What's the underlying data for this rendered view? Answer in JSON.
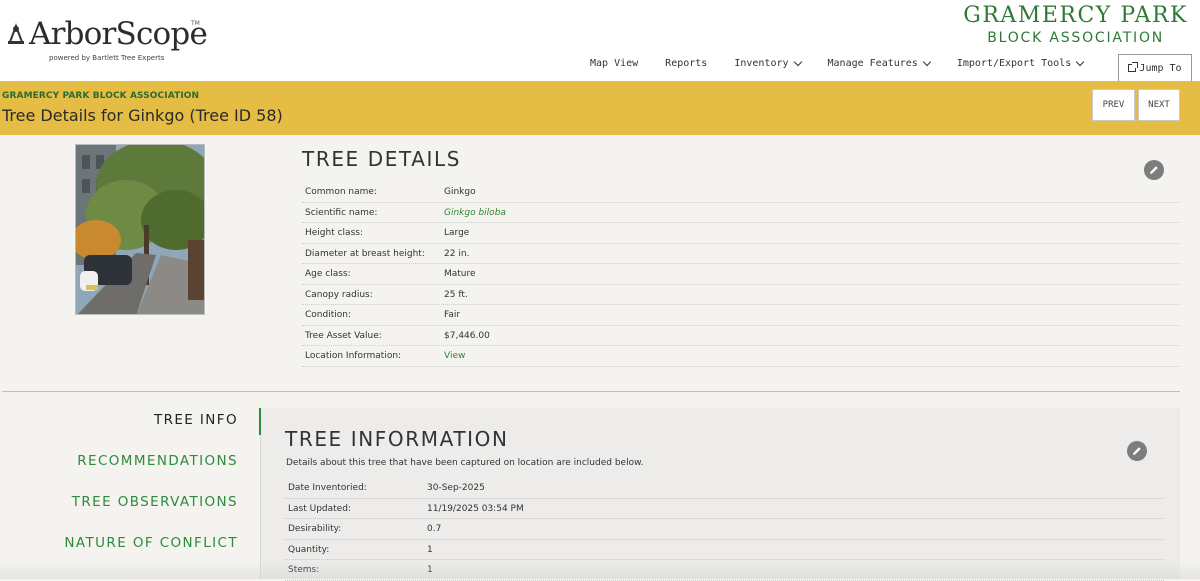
{
  "header": {
    "logo_text": "ArborScope",
    "logo_tm": "TM",
    "logo_sub": "powered by Bartlett Tree Experts",
    "brand_line1": "GRAMERCY PARK",
    "brand_line2": "BLOCK ASSOCIATION",
    "brand_color": "#2e7a34",
    "nav": {
      "map_view": "Map View",
      "reports": "Reports",
      "inventory": "Inventory",
      "manage_features": "Manage Features",
      "import_export": "Import/Export Tools",
      "jump_to": "Jump To"
    }
  },
  "titlebar": {
    "org": "GRAMERCY PARK BLOCK ASSOCIATION",
    "title": "Tree Details for Ginkgo (Tree ID 58)",
    "prev": "PREV",
    "next": "NEXT",
    "color": "#e5bc44"
  },
  "tree_details": {
    "heading": "TREE DETAILS",
    "rows": [
      {
        "label": "Common name:",
        "value": "Ginkgo"
      },
      {
        "label": "Scientific name:",
        "value": "Ginkgo biloba"
      },
      {
        "label": "Height class:",
        "value": "Large"
      },
      {
        "label": "Diameter at breast height:",
        "value": "22 in."
      },
      {
        "label": "Age class:",
        "value": "Mature"
      },
      {
        "label": "Canopy radius:",
        "value": "25 ft."
      },
      {
        "label": "Condition:",
        "value": "Fair"
      },
      {
        "label": "Tree Asset Value:",
        "value": "$7,446.00"
      },
      {
        "label": "Location Information:",
        "value": "View"
      }
    ]
  },
  "side_nav": {
    "tree_info": "TREE INFO",
    "recommendations": "RECOMMENDATIONS",
    "tree_observations": "TREE OBSERVATIONS",
    "nature_of_conflict": "NATURE OF CONFLICT"
  },
  "tree_information": {
    "heading": "TREE INFORMATION",
    "description": "Details about this tree that have been captured on location are included below.",
    "rows": [
      {
        "label": "Date Inventoried:",
        "value": "30-Sep-2025"
      },
      {
        "label": "Last Updated:",
        "value": "11/19/2025 03:54 PM"
      },
      {
        "label": "Desirability:",
        "value": "0.7"
      },
      {
        "label": "Quantity:",
        "value": "1"
      },
      {
        "label": "Stems:",
        "value": "1"
      }
    ]
  }
}
